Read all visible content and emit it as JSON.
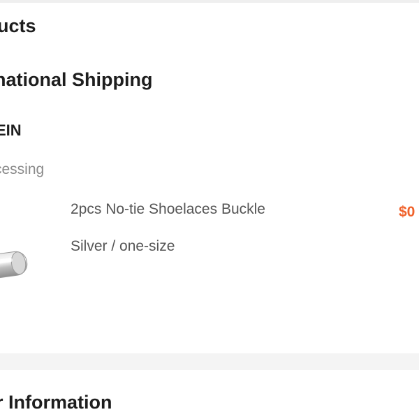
{
  "products_section": {
    "title": "ucts"
  },
  "shipping": {
    "title": "national Shipping",
    "seller": "EIN",
    "status": "cessing"
  },
  "product": {
    "name": "2pcs No-tie Shoelaces Buckle",
    "variant": "Silver / one-size",
    "price": "$0",
    "image_icon": "shoelace-buckle-image"
  },
  "order_info": {
    "title": "r Information"
  },
  "colors": {
    "price": "#f0622b",
    "background": "#f4f4f4",
    "card": "#ffffff"
  }
}
